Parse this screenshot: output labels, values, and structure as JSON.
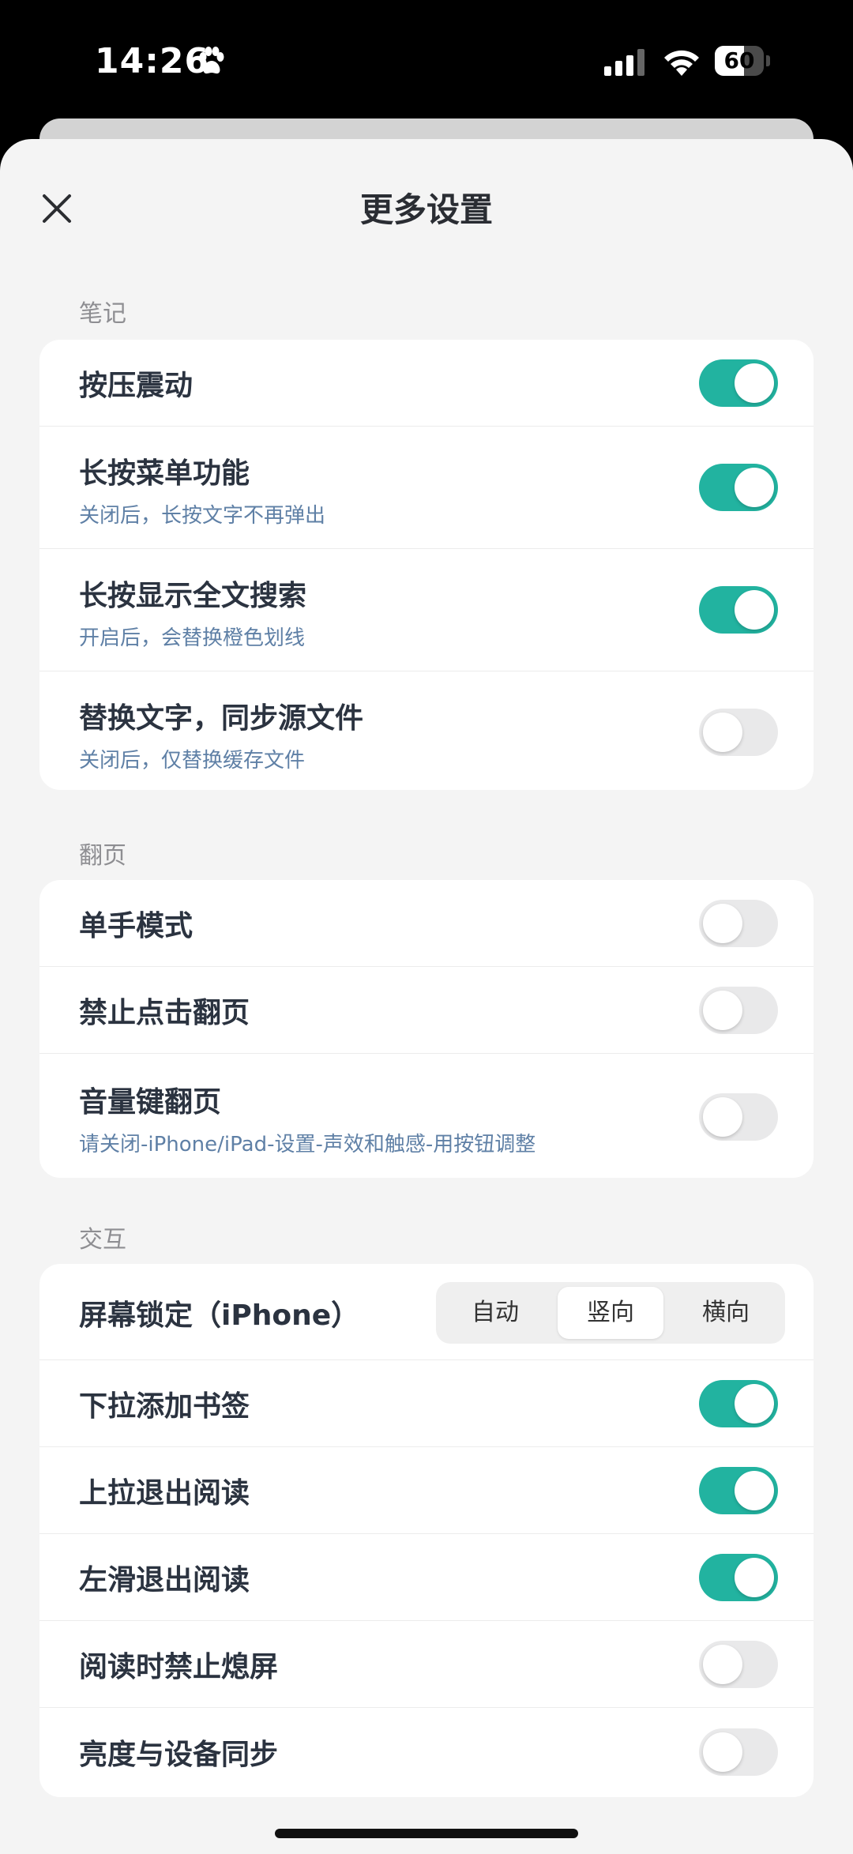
{
  "status_bar": {
    "time": "14:26",
    "battery": "60",
    "battery_level": 0.6
  },
  "header": {
    "title": "更多设置"
  },
  "sections": [
    {
      "label": "笔记",
      "rows": [
        {
          "title": "按压震动",
          "subtitle": "",
          "on": true
        },
        {
          "title": "长按菜单功能",
          "subtitle": "关闭后，长按文字不再弹出",
          "on": true
        },
        {
          "title": "长按显示全文搜索",
          "subtitle": "开启后，会替换橙色划线",
          "on": true
        },
        {
          "title": "替换文字，同步源文件",
          "subtitle": "关闭后，仅替换缓存文件",
          "on": false
        }
      ]
    },
    {
      "label": "翻页",
      "rows": [
        {
          "title": "单手模式",
          "subtitle": "",
          "on": false
        },
        {
          "title": "禁止点击翻页",
          "subtitle": "",
          "on": false
        },
        {
          "title": "音量键翻页",
          "subtitle": "请关闭-iPhone/iPad-设置-声效和触感-用按钮调整",
          "on": false
        }
      ]
    },
    {
      "label": "交互",
      "rows": [
        {
          "title": "屏幕锁定（iPhone）",
          "segmented": [
            "自动",
            "竖向",
            "横向"
          ],
          "selected": "竖向"
        },
        {
          "title": "下拉添加书签",
          "subtitle": "",
          "on": true
        },
        {
          "title": "上拉退出阅读",
          "subtitle": "",
          "on": true
        },
        {
          "title": "左滑退出阅读",
          "subtitle": "",
          "on": true
        },
        {
          "title": "阅读时禁止熄屏",
          "subtitle": "",
          "on": false
        },
        {
          "title": "亮度与设备同步",
          "subtitle": "",
          "on": false
        }
      ]
    }
  ],
  "colors": {
    "accent": "#22b3a0",
    "toggle_off": "#e9e9ea",
    "subtitle": "#5f80a6",
    "background": "#f4f4f4"
  },
  "icons": {
    "close": "close-icon",
    "paw": "paw-icon",
    "signal": "signal-icon",
    "wifi": "wifi-icon",
    "battery": "battery-icon"
  }
}
